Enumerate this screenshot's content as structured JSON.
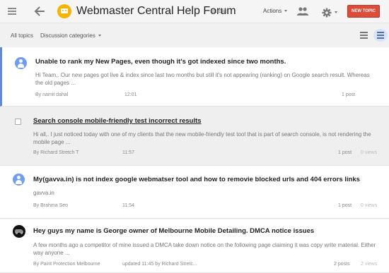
{
  "header": {
    "forum_title": "Webmaster Central Help Forum",
    "visibility": "public",
    "actions_label": "Actions",
    "new_topic_label": "NEW TOPIC",
    "icons": [
      "menu-icon",
      "back-arrow-icon",
      "forum-logo-icon",
      "people-icon",
      "gear-icon"
    ],
    "accent_color": "#dd4b39",
    "logo_color": "#f4b400"
  },
  "subnav": {
    "all_topics": "All topics",
    "categories": "Discussion categories"
  },
  "topics": [
    {
      "title": "Unable to rank my New Pages, even though it's got indexed since two months.",
      "snippet": "Hi Team,. Our new pages got live & index since last two months but still it's not appearing (ranking) on Google search result. Whereas the old pages ...",
      "author": "By namit dahal",
      "time": "12:01",
      "posts": "1 post",
      "views": "",
      "avatar": "default-avatar-icon"
    },
    {
      "title": "Search console mobile-friendly test incorrect results",
      "snippet": "Hi all,. I just noticed today with one of my clients that the new mobile-friendly test tool that is part of search console, is not rendering the mobile page ...",
      "author": "By Richard Stretch T",
      "time": "11:57",
      "posts": "1 post",
      "views": "0 views",
      "avatar": "checkbox"
    },
    {
      "title": "My(gavva.in) is not index google webmatser tool and how to removie blocked urls and 404 errors links",
      "snippet": "gavva.in",
      "author": "By Brahma Seo",
      "time": "11:54",
      "posts": "1 post",
      "views": "0 views",
      "avatar": "default-avatar-icon"
    },
    {
      "title": "Hey guys my name is George owner of Melbourne Mobile Detailing. DMCA notice issues",
      "snippet": "A few months ago a competitor of mine issued a DMCA take down notice on the following page claiming it was copy write material. Either way anyone ...",
      "author": "By Paint Protection Melbourne",
      "time": "updated 11:45 by Richard Stretc...",
      "posts": "2 posts",
      "views": "2 views",
      "avatar": "profile-photo"
    }
  ]
}
